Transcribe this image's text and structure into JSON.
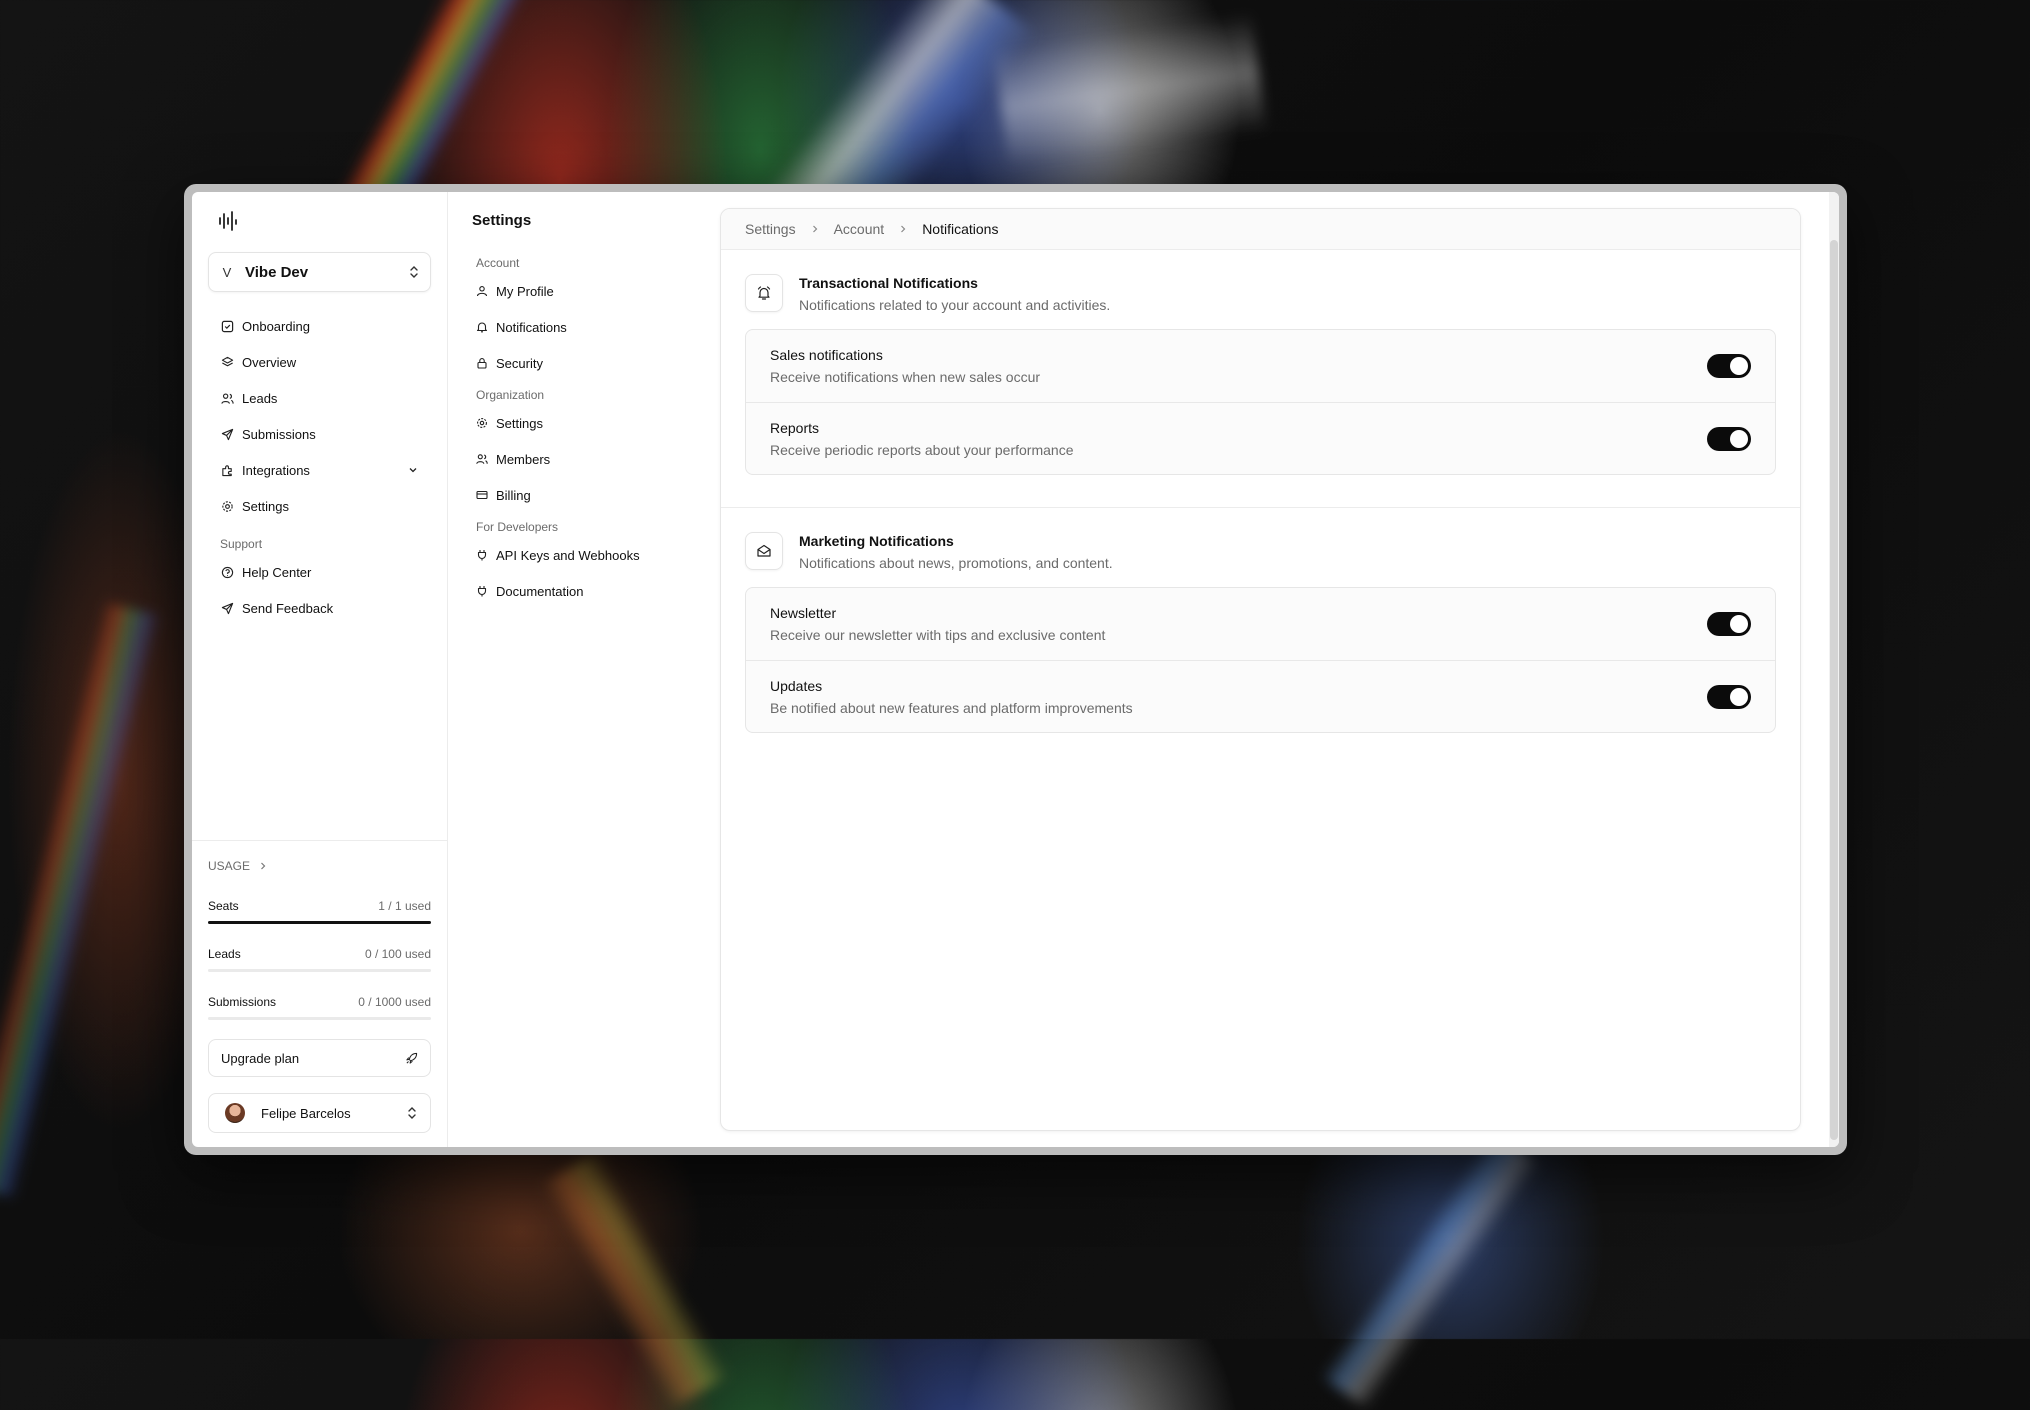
{
  "sidebar": {
    "workspace": {
      "initial": "V",
      "name": "Vibe Dev"
    },
    "items": [
      {
        "label": "Onboarding",
        "icon": "checkbox-icon"
      },
      {
        "label": "Overview",
        "icon": "layers-icon"
      },
      {
        "label": "Leads",
        "icon": "users-icon"
      },
      {
        "label": "Submissions",
        "icon": "send-icon"
      },
      {
        "label": "Integrations",
        "icon": "puzzle-icon"
      },
      {
        "label": "Settings",
        "icon": "gear-icon"
      }
    ],
    "support_label": "Support",
    "support_items": [
      {
        "label": "Help Center",
        "icon": "help-circle-icon"
      },
      {
        "label": "Send Feedback",
        "icon": "send-icon"
      }
    ],
    "usage": {
      "label": "USAGE",
      "rows": [
        {
          "label": "Seats",
          "value": "1 / 1 used",
          "fraction": 1.0
        },
        {
          "label": "Leads",
          "value": "0 / 100 used",
          "fraction": 0.0
        },
        {
          "label": "Submissions",
          "value": "0 / 1000 used",
          "fraction": 0.0
        }
      ]
    },
    "upgrade_label": "Upgrade plan",
    "user_name": "Felipe Barcelos"
  },
  "settings_nav": {
    "title": "Settings",
    "sections": [
      {
        "label": "Account",
        "items": [
          "My Profile",
          "Notifications",
          "Security"
        ]
      },
      {
        "label": "Organization",
        "items": [
          "Settings",
          "Members",
          "Billing"
        ]
      },
      {
        "label": "For Developers",
        "items": [
          "API Keys and Webhooks",
          "Documentation"
        ]
      }
    ]
  },
  "breadcrumb": [
    "Settings",
    "Account",
    "Notifications"
  ],
  "sections": [
    {
      "title": "Transactional Notifications",
      "description": "Notifications related to your account and activities.",
      "icon": "bell-icon",
      "options": [
        {
          "title": "Sales notifications",
          "description": "Receive notifications when new sales occur",
          "enabled": true
        },
        {
          "title": "Reports",
          "description": "Receive periodic reports about your performance",
          "enabled": true
        }
      ]
    },
    {
      "title": "Marketing Notifications",
      "description": "Notifications about news, promotions, and content.",
      "icon": "mail-open-icon",
      "options": [
        {
          "title": "Newsletter",
          "description": "Receive our newsletter with tips and exclusive content",
          "enabled": true
        },
        {
          "title": "Updates",
          "description": "Be notified about new features and platform improvements",
          "enabled": true
        }
      ]
    }
  ],
  "colors": {
    "toggle_on": "#0b0b0b",
    "muted_text": "#6b6b6b",
    "border": "#e6e6e6"
  }
}
